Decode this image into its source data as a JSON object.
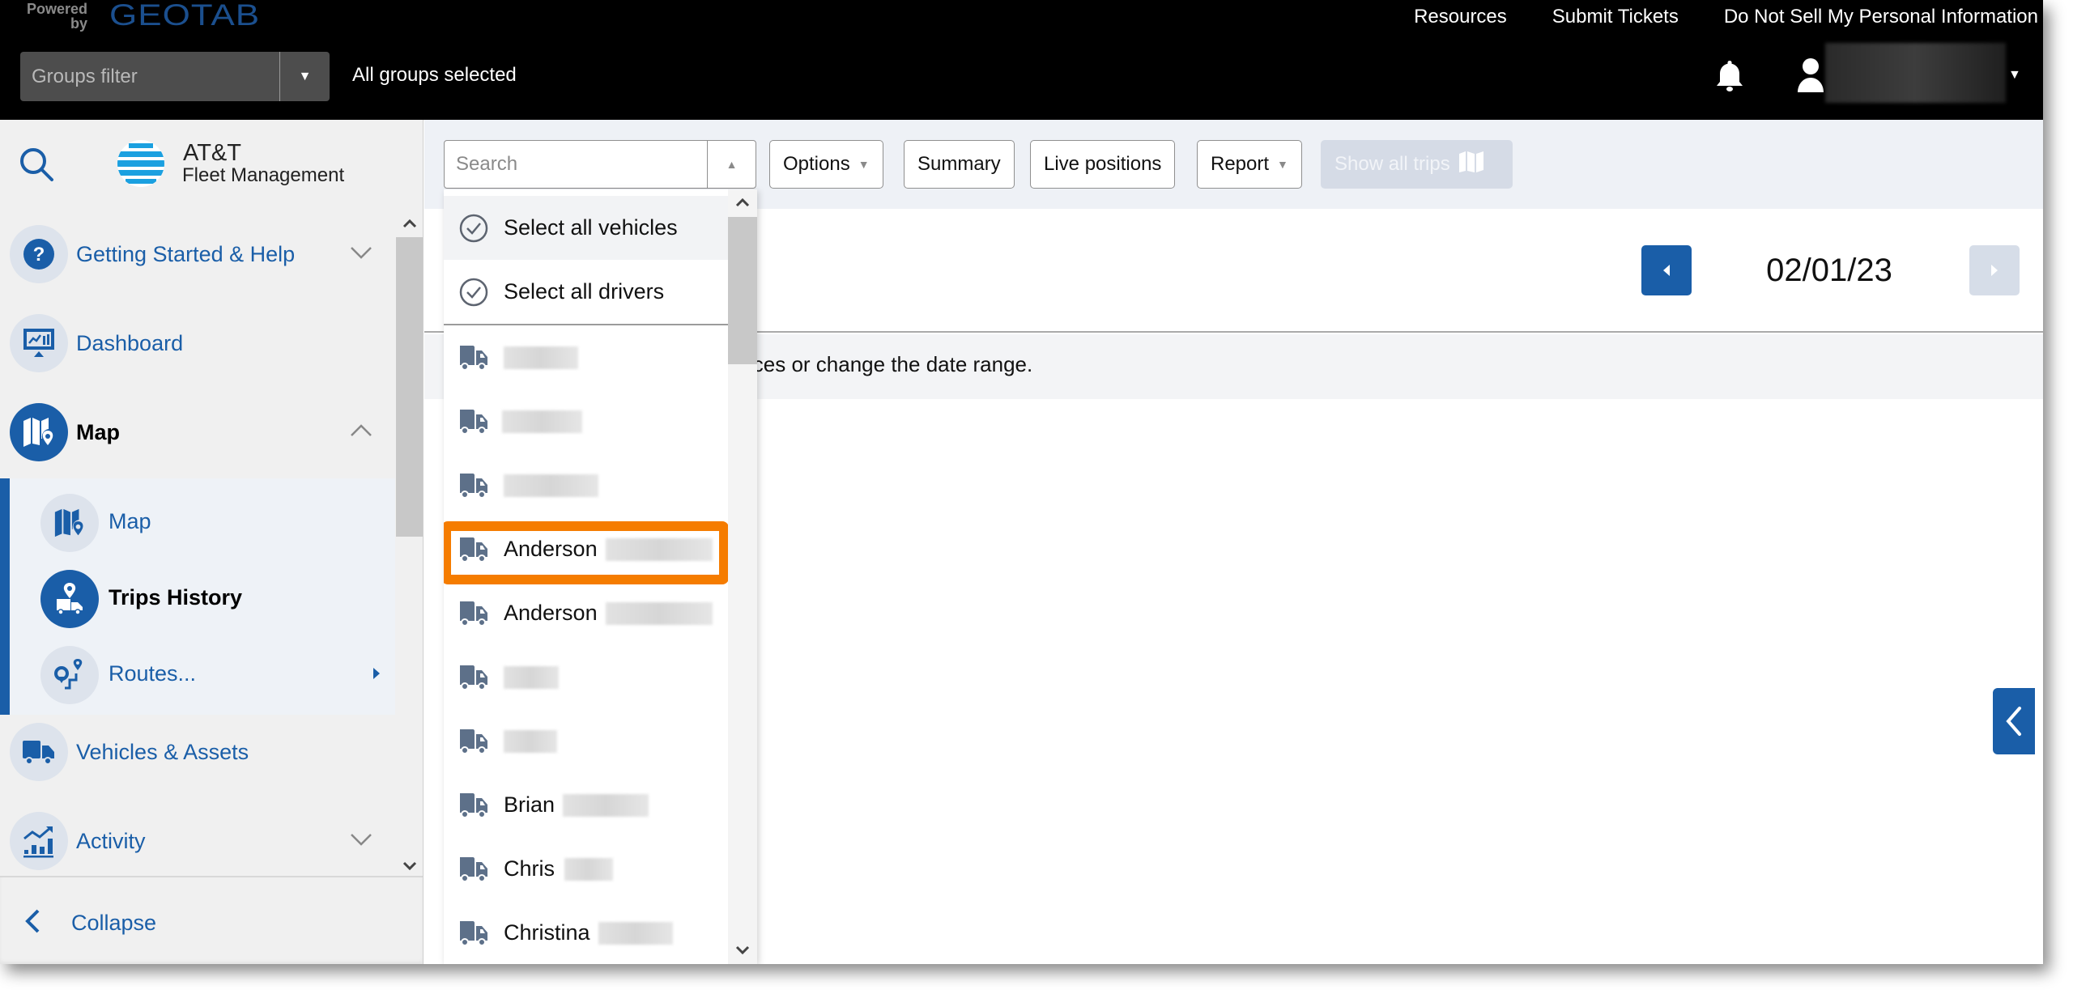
{
  "header": {
    "powered_by": "Powered by",
    "brand": "GEOTAB",
    "links": [
      "Resources",
      "Submit Tickets",
      "Do Not Sell My Personal Information"
    ],
    "groups_filter": {
      "placeholder": "Groups filter",
      "status": "All groups selected"
    },
    "user_name": "[redacted]"
  },
  "sidebar": {
    "logo": {
      "title": "AT&T",
      "subtitle": "Fleet Management"
    },
    "items": [
      {
        "label": "Getting Started & Help",
        "icon": "help-icon",
        "expandable": true,
        "expanded": false
      },
      {
        "label": "Dashboard",
        "icon": "dashboard-icon",
        "expandable": false
      },
      {
        "label": "Map",
        "icon": "map-icon",
        "expandable": true,
        "expanded": true,
        "active": true
      },
      {
        "label": "Vehicles & Assets",
        "icon": "truck-icon",
        "expandable": false
      },
      {
        "label": "Activity",
        "icon": "activity-icon",
        "expandable": true,
        "expanded": false
      }
    ],
    "map_subitems": [
      {
        "label": "Map",
        "icon": "map-icon"
      },
      {
        "label": "Trips History",
        "icon": "trips-history-icon",
        "active": true
      },
      {
        "label": "Routes...",
        "icon": "routes-icon",
        "has_submenu": true
      }
    ],
    "collapse_label": "Collapse"
  },
  "toolbar": {
    "search_placeholder": "Search",
    "search_value": "",
    "buttons": {
      "options": "Options",
      "summary": "Summary",
      "live_positions": "Live positions",
      "report": "Report",
      "show_all_trips": "Show all trips"
    }
  },
  "dropdown": {
    "select_all_vehicles": "Select all vehicles",
    "select_all_drivers": "Select all drivers",
    "items": [
      {
        "name": "",
        "redacted": true
      },
      {
        "name": "",
        "redacted": true
      },
      {
        "name": "",
        "redacted": true
      },
      {
        "name": "Anderson",
        "redacted": true,
        "highlighted": true
      },
      {
        "name": "Anderson",
        "redacted": true
      },
      {
        "name": "",
        "redacted": true
      },
      {
        "name": "",
        "redacted": true
      },
      {
        "name": "Brian",
        "redacted": true
      },
      {
        "name": "Chris",
        "redacted": true
      },
      {
        "name": "Christina",
        "redacted": true
      }
    ]
  },
  "content": {
    "date": "02/01/23",
    "notice_visible_text": "ices or change the date range."
  },
  "colors": {
    "brand_blue": "#1a5ea8",
    "highlight_orange": "#f57c00",
    "header_bg": "#000000"
  }
}
